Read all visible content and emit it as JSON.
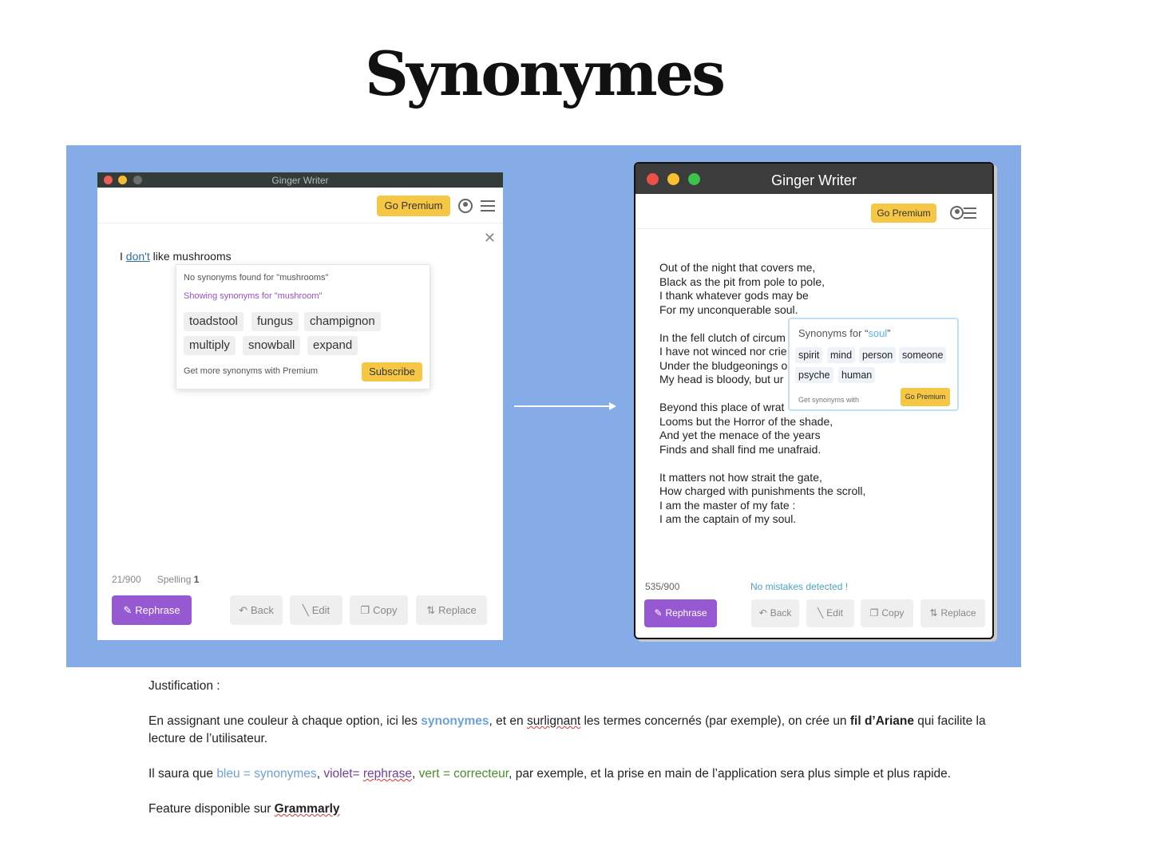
{
  "page": {
    "title": "Synonymes"
  },
  "left_window": {
    "title": "Ginger Writer",
    "premium_label": "Go Premium",
    "sentence": {
      "before": "I ",
      "highlighted": "don't",
      "after": " like mushrooms"
    },
    "popup": {
      "no_result": "No synonyms found for \"mushrooms\"",
      "showing": "Showing synonyms for \"mushroom\"",
      "synonyms": [
        "toadstool",
        "fungus",
        "champignon",
        "multiply",
        "snowball",
        "expand"
      ],
      "footer": "Get more synonyms with Premium",
      "subscribe_label": "Subscribe"
    },
    "status": {
      "count": "21/900",
      "spelling_label": "Spelling",
      "spelling_count": "1"
    },
    "actions": {
      "rephrase": "Rephrase",
      "back": "Back",
      "edit": "Edit",
      "copy": "Copy",
      "replace": "Replace"
    }
  },
  "right_window": {
    "title": "Ginger Writer",
    "premium_label": "Go Premium",
    "poem": [
      [
        "Out of the night that covers me,",
        "Black as the pit from pole to pole,",
        "I thank whatever gods may be",
        "For my unconquerable soul."
      ],
      [
        "In the fell clutch of circum",
        "I have not winced nor crie",
        "Under the bludgeonings o",
        "My head is bloody, but ur"
      ],
      [
        "Beyond this place of wrat",
        "Looms but the Horror of the shade,",
        "And yet the menace of the years",
        "Finds and shall find me unafraid."
      ],
      [
        "It matters not how strait the gate,",
        "How charged with punishments the scroll,",
        "I am the master of my fate :",
        "I am the captain of my soul."
      ]
    ],
    "popup": {
      "head_prefix": "Synonyms for “",
      "head_word": "soul",
      "head_suffix": "”",
      "synonyms": [
        "spirit",
        "mind",
        "person",
        "someone",
        "psyche",
        "human"
      ],
      "footer": "Get synonyms with",
      "premium_label": "Go Premium"
    },
    "status": {
      "count": "535/900",
      "message": "No mistakes detected !"
    },
    "actions": {
      "rephrase": "Rephrase",
      "back": "Back",
      "edit": "Edit",
      "copy": "Copy",
      "replace": "Replace"
    }
  },
  "text": {
    "justification": "Justification :",
    "p1": {
      "a": "En assignant une couleur à chaque option, ici les ",
      "b": "synonymes",
      "c": ", et en ",
      "d": "surlignant",
      "e": " les termes concernés (par exemple), on crée un ",
      "f": "fil d’Ariane",
      "g": " qui facilite la lecture de l’utilisateur."
    },
    "p2": {
      "a": "Il saura que ",
      "b": "bleu = synonymes",
      "c": ", ",
      "d": "violet= ",
      "e": "rephrase",
      "f": ", ",
      "g": "vert = correcteur",
      "h": ", par exemple, et la prise en main de l’application sera plus simple et plus rapide."
    },
    "p3": {
      "a": "Feature disponible sur ",
      "b": "Grammarly"
    }
  },
  "colors": {
    "panel": "#86ace8",
    "premium": "#f6c744",
    "rephrase": "#9659d2",
    "synonyms_blue": "#6da1d9",
    "violet": "#6f3f9a",
    "green": "#4a8c2a"
  }
}
